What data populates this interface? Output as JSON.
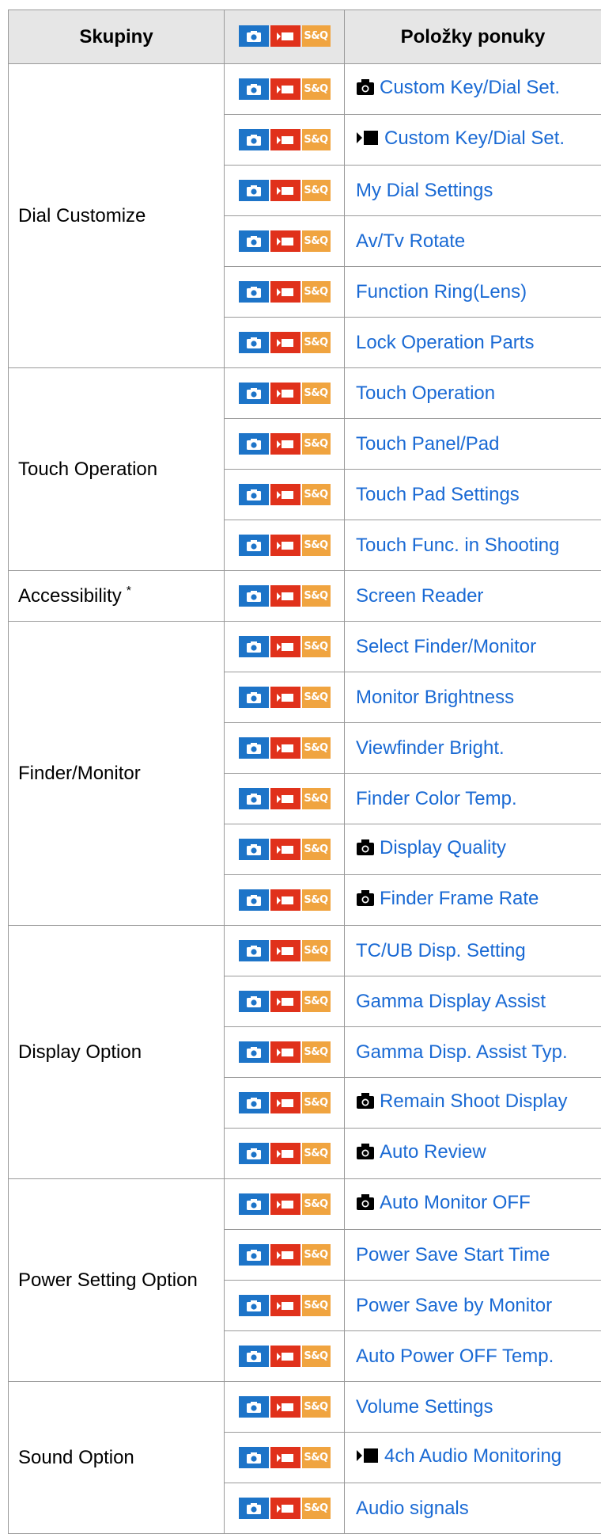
{
  "header": {
    "col_groups": "Skupiny",
    "col_items": "Položky ponuky",
    "mode_sq_label": "S&Q"
  },
  "mode_icons": {
    "photo": "camera-mode-icon",
    "movie": "movie-mode-icon",
    "sq": "S&Q"
  },
  "colors": {
    "photo": "#1d74c8",
    "movie": "#e0311b",
    "sq": "#f0a440",
    "link": "#1a6ad4"
  },
  "groups": [
    {
      "name": "Dial Customize",
      "footnote": "",
      "items": [
        {
          "label": "Custom Key/Dial Set.",
          "prefix": "camera"
        },
        {
          "label": "Custom Key/Dial Set.",
          "prefix": "movie"
        },
        {
          "label": "My Dial Settings",
          "prefix": ""
        },
        {
          "label": "Av/Tv Rotate",
          "prefix": ""
        },
        {
          "label": "Function Ring(Lens)",
          "prefix": ""
        },
        {
          "label": "Lock Operation Parts",
          "prefix": ""
        }
      ]
    },
    {
      "name": "Touch Operation",
      "footnote": "",
      "items": [
        {
          "label": "Touch Operation",
          "prefix": ""
        },
        {
          "label": "Touch Panel/Pad",
          "prefix": ""
        },
        {
          "label": "Touch Pad Settings",
          "prefix": ""
        },
        {
          "label": "Touch Func. in Shooting",
          "prefix": ""
        }
      ]
    },
    {
      "name": "Accessibility",
      "footnote": "*",
      "items": [
        {
          "label": "Screen Reader",
          "prefix": ""
        }
      ]
    },
    {
      "name": "Finder/Monitor",
      "footnote": "",
      "items": [
        {
          "label": "Select Finder/Monitor",
          "prefix": ""
        },
        {
          "label": "Monitor Brightness",
          "prefix": ""
        },
        {
          "label": "Viewfinder Bright.",
          "prefix": ""
        },
        {
          "label": "Finder Color Temp.",
          "prefix": ""
        },
        {
          "label": "Display Quality",
          "prefix": "camera"
        },
        {
          "label": "Finder Frame Rate",
          "prefix": "camera"
        }
      ]
    },
    {
      "name": "Display Option",
      "footnote": "",
      "items": [
        {
          "label": "TC/UB Disp. Setting",
          "prefix": ""
        },
        {
          "label": "Gamma Display Assist",
          "prefix": ""
        },
        {
          "label": "Gamma Disp. Assist Typ.",
          "prefix": ""
        },
        {
          "label": "Remain Shoot Display",
          "prefix": "camera"
        },
        {
          "label": "Auto Review",
          "prefix": "camera"
        }
      ]
    },
    {
      "name": "Power Setting Option",
      "footnote": "",
      "items": [
        {
          "label": "Auto Monitor OFF",
          "prefix": "camera"
        },
        {
          "label": "Power Save Start Time",
          "prefix": ""
        },
        {
          "label": "Power Save by Monitor",
          "prefix": ""
        },
        {
          "label": "Auto Power OFF Temp.",
          "prefix": ""
        }
      ]
    },
    {
      "name": "Sound Option",
      "footnote": "",
      "items": [
        {
          "label": "Volume Settings",
          "prefix": ""
        },
        {
          "label": "4ch Audio Monitoring",
          "prefix": "movie"
        },
        {
          "label": "Audio signals",
          "prefix": ""
        }
      ]
    }
  ]
}
